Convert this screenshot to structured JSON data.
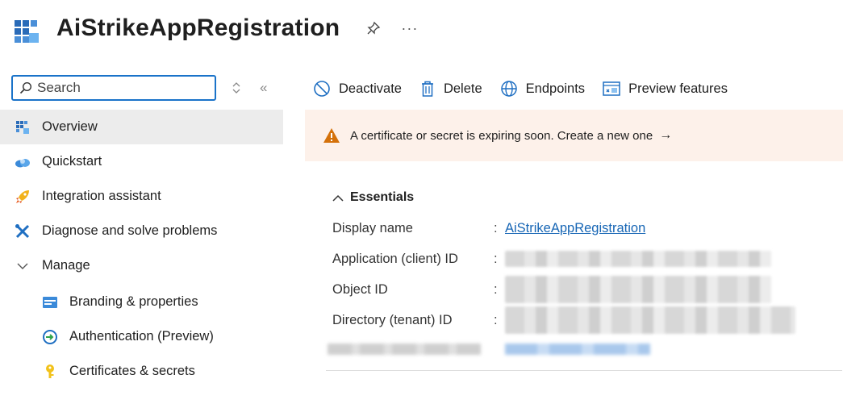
{
  "header": {
    "title": "AiStrikeAppRegistration",
    "more": "···"
  },
  "sidebar": {
    "search_placeholder": "Search",
    "collapse": "«",
    "items": [
      {
        "label": "Overview",
        "icon": "app-registration-icon"
      },
      {
        "label": "Quickstart",
        "icon": "cloud-icon"
      },
      {
        "label": "Integration assistant",
        "icon": "rocket-icon"
      },
      {
        "label": "Diagnose and solve problems",
        "icon": "tools-icon"
      },
      {
        "label": "Manage",
        "icon": "chevron-down-icon"
      },
      {
        "label": "Branding & properties",
        "icon": "branding-icon"
      },
      {
        "label": "Authentication (Preview)",
        "icon": "authentication-icon"
      },
      {
        "label": "Certificates & secrets",
        "icon": "key-icon"
      }
    ]
  },
  "toolbar": {
    "deactivate": "Deactivate",
    "delete": "Delete",
    "endpoints": "Endpoints",
    "preview_features": "Preview features"
  },
  "banner": {
    "text": "A certificate or secret is expiring soon. Create a new one",
    "arrow": "→"
  },
  "essentials": {
    "title": "Essentials",
    "rows": [
      {
        "label": "Display name",
        "value": "AiStrikeAppRegistration"
      },
      {
        "label": "Application (client) ID",
        "value": ""
      },
      {
        "label": "Object ID",
        "value": ""
      },
      {
        "label": "Directory (tenant) ID",
        "value": ""
      }
    ]
  },
  "colors": {
    "accent": "#1a73c9",
    "link": "#1766b5",
    "banner_bg": "#fdf1ea",
    "warning": "#d4710a"
  }
}
